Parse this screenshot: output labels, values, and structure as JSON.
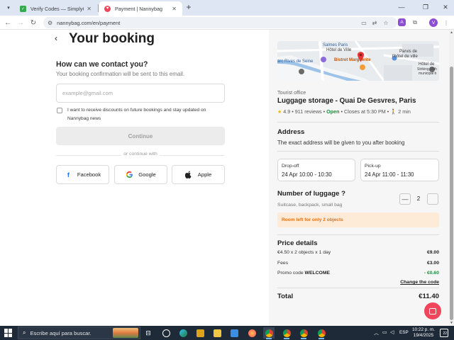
{
  "browser": {
    "tabs": [
      {
        "title": "Verify Codes — SimplyCodes",
        "favicon": "simplycodes-icon",
        "favicon_color": "#34a853"
      },
      {
        "title": "Payment | Nannybag",
        "favicon": "nannybag-icon",
        "favicon_color": "#f0465b"
      }
    ],
    "url": "nannybag.com/en/payment",
    "profile_initial": "V",
    "ext_badge": "A"
  },
  "page": {
    "title": "Your booking",
    "contact": {
      "title": "How can we contact you?",
      "subtitle": "Your booking confirmation will be sent to this email.",
      "email_placeholder": "example@gmail.com",
      "email_value": "",
      "newsletter_label": "I want to receive discounts on future bookings and stay updated on Nannybag news",
      "newsletter_checked": false,
      "continue_label": "Continue",
      "or_text": "or continue with",
      "social": [
        {
          "label": "Facebook",
          "icon": "facebook-icon"
        },
        {
          "label": "Google",
          "icon": "google-icon"
        },
        {
          "label": "Apple",
          "icon": "apple-icon"
        }
      ]
    }
  },
  "summary": {
    "map_labels": {
      "l1": "Salmes Paris",
      "l2": "Hôtel de Ville",
      "l3": "Bistrot Marguerite",
      "l4": "Parvis de",
      "l5": "l'hôtel de ville",
      "l6": "arc Rives de Seine",
      "l7": "Hôtel de",
      "l8": "Striking 19th",
      "l9": "municipal b"
    },
    "place_type": "Tourist office",
    "place_name": "Luggage storage - Quai De Gesvres, Paris",
    "rating": "4.9",
    "reviews": "911 reviews",
    "open_status": "Open",
    "closes": "Closes at 5:30 PM",
    "walk": "2 min",
    "address_title": "Address",
    "address_sub": "The exact address will be given to you after booking",
    "dropoff_label": "Drop-off",
    "dropoff_value": "24 Apr 10:00 - 10:30",
    "pickup_label": "Pick-up",
    "pickup_value": "24 Apr 11:00 - 11:30",
    "luggage_title": "Number of luggage ?",
    "luggage_sub": "Suitcase, backpack, small bag",
    "luggage_count": "2",
    "warning": "Room left for only 2 objects",
    "price_title": "Price details",
    "line1_label": "€4.50 x 2 objects x 1 day",
    "line1_amount": "€9.00",
    "fees_label": "Fees",
    "fees_amount": "€3.00",
    "promo_prefix": "Promo code",
    "promo_code": "WELCOME",
    "promo_amount": "- €0.60",
    "change_code": "Change the code",
    "total_label": "Total",
    "total_amount": "€11.40"
  },
  "taskbar": {
    "search_placeholder": "Escribe aquí para buscar.",
    "lang": "ESP",
    "time": "10:22 p. m.",
    "date": "19/4/2025",
    "notifications": "22"
  },
  "colors": {
    "accent": "#f0465b",
    "open_green": "#1e8e3e",
    "warning_bg": "#fdebd8",
    "warning_text": "#d9731c"
  }
}
